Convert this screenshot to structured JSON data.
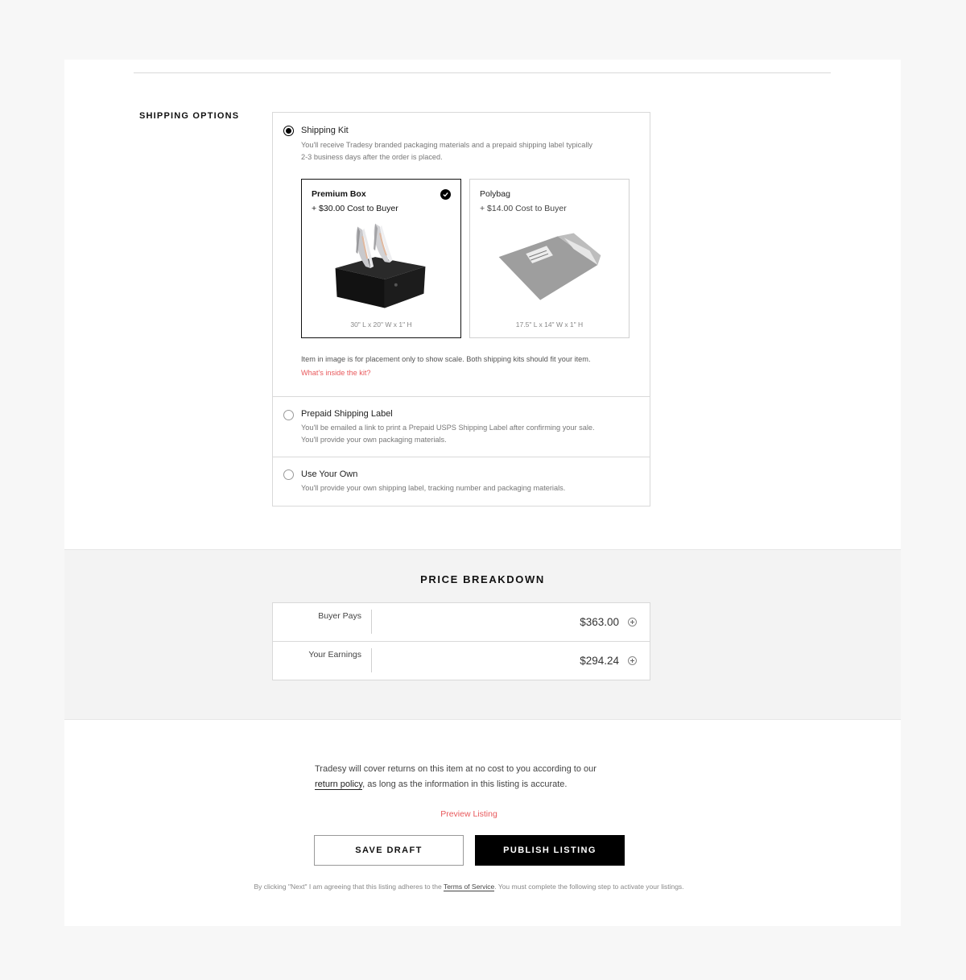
{
  "shipping": {
    "section_label": "SHIPPING OPTIONS",
    "kit": {
      "title": "Shipping Kit",
      "desc_line1": "You'll receive Tradesy branded packaging materials and a prepaid shipping label typically",
      "desc_line2": "2-3 business days after the order is placed.",
      "boxes": [
        {
          "name": "Premium Box",
          "price": "+ $30.00 Cost to Buyer",
          "dims": "30\" L x 20\" W x 1\" H",
          "selected": true,
          "image": "black-box-with-silver-heels"
        },
        {
          "name": "Polybag",
          "price": "+ $14.00 Cost to Buyer",
          "dims": "17.5\" L x 14\" W x 1\" H",
          "selected": false,
          "image": "grey-polybag"
        }
      ],
      "note": "Item in image is for placement only to show scale. Both shipping kits should fit your item.",
      "link": "What's inside the kit?"
    },
    "label": {
      "title": "Prepaid Shipping Label",
      "desc_line1": "You'll be emailed a link to print a Prepaid USPS Shipping Label after confirming your sale.",
      "desc_line2": "You'll provide your own packaging materials."
    },
    "own": {
      "title": "Use Your Own",
      "desc_line1": "You'll provide your own shipping label, tracking number and packaging materials."
    }
  },
  "price": {
    "title": "PRICE BREAKDOWN",
    "rows": [
      {
        "label": "Buyer Pays",
        "value": "$363.00"
      },
      {
        "label": "Your Earnings",
        "value": "$294.24"
      }
    ]
  },
  "footer": {
    "returns_pre": "Tradesy will cover returns on this item at no cost to you according to our",
    "returns_link": "return policy",
    "returns_post": ", as long as the information in this listing is accurate.",
    "preview": "Preview Listing",
    "save": "SAVE DRAFT",
    "publish": "PUBLISH LISTING",
    "fine_pre": "By clicking \"Next\" I am agreeing that this listing adheres to the",
    "fine_link": "Terms of Service",
    "fine_post": ". You must complete the following step to activate your listings."
  },
  "colors": {
    "accent": "#e8595c",
    "primary": "#000000",
    "band": "#f3f3f3"
  }
}
